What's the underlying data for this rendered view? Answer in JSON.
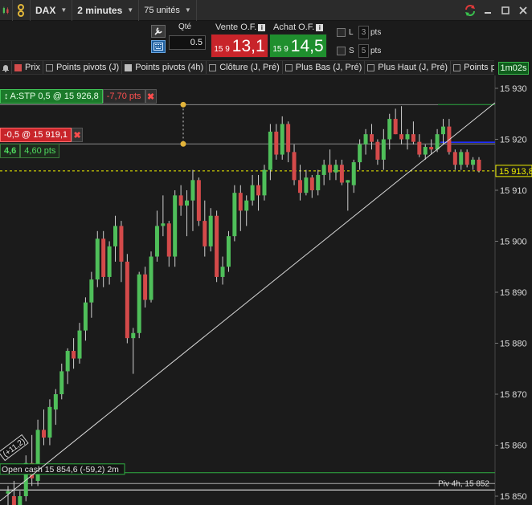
{
  "toolbar": {
    "instrument": "DAX",
    "timeframe": "2 minutes",
    "units": "75 unités"
  },
  "order": {
    "qty_label": "Qté",
    "qty_value": "0.5",
    "sell_label": "Vente O.F.",
    "sell_prefix": "15 9",
    "sell_price": "13,1",
    "buy_label": "Achat O.F.",
    "buy_prefix": "15 9",
    "buy_price": "14,5",
    "info_glyph": "i",
    "limit_label": "L",
    "limit_pts": "3",
    "stop_label": "S",
    "stop_pts": "5",
    "pts_label": "pts"
  },
  "indicators": [
    {
      "label": "Prix",
      "color": "#d24b4b"
    },
    {
      "label": "Points pivots (J)",
      "color": ""
    },
    {
      "label": "Points pivots (4h)",
      "color": "#bbbbbb"
    },
    {
      "label": "Clôture (J, Pré)",
      "color": ""
    },
    {
      "label": "Plus Bas (J, Pré)",
      "color": ""
    },
    {
      "label": "Plus Haut (J, Pré)",
      "color": ""
    },
    {
      "label": "Points piv",
      "color": ""
    }
  ],
  "timer": "1m02s",
  "positions": {
    "stop_order": {
      "name": "A:STP",
      "detail": "0,5 @ 15 926,8",
      "pnl": "-7,70 pts"
    },
    "limit_order": {
      "detail": "-0,5 @ 15 919,1"
    },
    "gain": {
      "value": "4,6",
      "pts": "4,60 pts"
    },
    "close_glyph": "✖"
  },
  "annotations": {
    "open_cash": "Open cash 15 854,6 (-59,2) 2m",
    "pivot": "Piv 4h, 15 852",
    "trend_tag": "(+11,2)"
  },
  "price_axis": {
    "labels": [
      "15 930",
      "15 920",
      "15 910",
      "15 900",
      "15 890",
      "15 880",
      "15 870",
      "15 860",
      "15 850"
    ],
    "current_price_label": "15 913,8"
  },
  "colors": {
    "up": "#4fbf5a",
    "down": "#d44a4a",
    "current_price": "#f2f200",
    "limit_line": "#1e2cff",
    "stop_line": "#1d8a2e",
    "grid": "#2c2c2c"
  },
  "chart_data": {
    "type": "candlestick",
    "price_range": [
      15845.5,
      15934
    ],
    "current_price": 15913.8,
    "levels": {
      "stop": 15926.8,
      "order": 15919.1,
      "limit": 15919.1,
      "pivot_4h": 15852,
      "open_cash": 15854.6
    },
    "candles": [
      {
        "o": 15850.5,
        "h": 15852.0,
        "l": 15845.5,
        "c": 15851.0
      },
      {
        "o": 15850.0,
        "h": 15853.0,
        "l": 15846.0,
        "c": 15847.0
      },
      {
        "o": 15847.0,
        "h": 15851.0,
        "l": 15845.5,
        "c": 15850.0
      },
      {
        "o": 15850.0,
        "h": 15858.0,
        "l": 15849.0,
        "c": 15856.5
      },
      {
        "o": 15856.5,
        "h": 15862.0,
        "l": 15852.0,
        "c": 15853.5
      },
      {
        "o": 15853.0,
        "h": 15865.0,
        "l": 15852.0,
        "c": 15863.0
      },
      {
        "o": 15863.0,
        "h": 15867.0,
        "l": 15860.0,
        "c": 15861.5
      },
      {
        "o": 15861.5,
        "h": 15869.0,
        "l": 15860.0,
        "c": 15867.5
      },
      {
        "o": 15867.0,
        "h": 15871.0,
        "l": 15864.0,
        "c": 15870.0
      },
      {
        "o": 15870.0,
        "h": 15876.0,
        "l": 15869.0,
        "c": 15874.5
      },
      {
        "o": 15874.5,
        "h": 15879.0,
        "l": 15872.0,
        "c": 15878.5
      },
      {
        "o": 15878.5,
        "h": 15881.0,
        "l": 15875.0,
        "c": 15877.0
      },
      {
        "o": 15877.0,
        "h": 15884.0,
        "l": 15876.0,
        "c": 15882.5
      },
      {
        "o": 15882.5,
        "h": 15889.0,
        "l": 15880.5,
        "c": 15888.0
      },
      {
        "o": 15888.0,
        "h": 15894.0,
        "l": 15885.0,
        "c": 15892.5
      },
      {
        "o": 15892.5,
        "h": 15902.0,
        "l": 15891.0,
        "c": 15900.5
      },
      {
        "o": 15900.5,
        "h": 15902.0,
        "l": 15891.0,
        "c": 15893.0
      },
      {
        "o": 15893.0,
        "h": 15900.0,
        "l": 15891.5,
        "c": 15899.0
      },
      {
        "o": 15899.0,
        "h": 15905.0,
        "l": 15896.0,
        "c": 15903.0
      },
      {
        "o": 15903.0,
        "h": 15904.0,
        "l": 15892.0,
        "c": 15896.0
      },
      {
        "o": 15896.0,
        "h": 15897.5,
        "l": 15880.0,
        "c": 15881.0
      },
      {
        "o": 15881.0,
        "h": 15883.0,
        "l": 15874.0,
        "c": 15882.0
      },
      {
        "o": 15882.0,
        "h": 15894.0,
        "l": 15881.0,
        "c": 15893.5
      },
      {
        "o": 15893.5,
        "h": 15895.0,
        "l": 15887.0,
        "c": 15888.5
      },
      {
        "o": 15888.5,
        "h": 15898.0,
        "l": 15888.0,
        "c": 15897.0
      },
      {
        "o": 15897.0,
        "h": 15906.0,
        "l": 15896.0,
        "c": 15903.0
      },
      {
        "o": 15903.0,
        "h": 15909.0,
        "l": 15901.0,
        "c": 15903.5
      },
      {
        "o": 15903.5,
        "h": 15904.0,
        "l": 15895.0,
        "c": 15897.0
      },
      {
        "o": 15897.0,
        "h": 15910.0,
        "l": 15895.0,
        "c": 15909.0
      },
      {
        "o": 15909.0,
        "h": 15911.0,
        "l": 15905.0,
        "c": 15907.0
      },
      {
        "o": 15907.0,
        "h": 15910.0,
        "l": 15901.0,
        "c": 15908.0
      },
      {
        "o": 15908.0,
        "h": 15914.0,
        "l": 15902.0,
        "c": 15912.0
      },
      {
        "o": 15912.0,
        "h": 15912.5,
        "l": 15903.0,
        "c": 15904.0
      },
      {
        "o": 15904.0,
        "h": 15908.0,
        "l": 15897.0,
        "c": 15899.0
      },
      {
        "o": 15899.0,
        "h": 15906.5,
        "l": 15898.0,
        "c": 15905.0
      },
      {
        "o": 15905.0,
        "h": 15906.0,
        "l": 15892.0,
        "c": 15893.0
      },
      {
        "o": 15893.0,
        "h": 15897.0,
        "l": 15891.5,
        "c": 15895.0
      },
      {
        "o": 15895.0,
        "h": 15902.0,
        "l": 15894.0,
        "c": 15901.0
      },
      {
        "o": 15901.0,
        "h": 15911.0,
        "l": 15900.0,
        "c": 15909.5
      },
      {
        "o": 15909.5,
        "h": 15911.0,
        "l": 15902.0,
        "c": 15906.0
      },
      {
        "o": 15906.0,
        "h": 15909.0,
        "l": 15903.0,
        "c": 15908.0
      },
      {
        "o": 15908.0,
        "h": 15913.0,
        "l": 15907.0,
        "c": 15911.0
      },
      {
        "o": 15911.0,
        "h": 15913.0,
        "l": 15906.0,
        "c": 15909.0
      },
      {
        "o": 15909.0,
        "h": 15915.0,
        "l": 15908.0,
        "c": 15914.0
      },
      {
        "o": 15914.0,
        "h": 15923.0,
        "l": 15912.0,
        "c": 15921.5
      },
      {
        "o": 15921.5,
        "h": 15923.0,
        "l": 15916.0,
        "c": 15917.0
      },
      {
        "o": 15917.0,
        "h": 15924.5,
        "l": 15916.0,
        "c": 15923.0
      },
      {
        "o": 15923.0,
        "h": 15923.5,
        "l": 15915.5,
        "c": 15917.5
      },
      {
        "o": 15917.5,
        "h": 15919.0,
        "l": 15911.0,
        "c": 15912.0
      },
      {
        "o": 15912.0,
        "h": 15915.0,
        "l": 15908.0,
        "c": 15909.5
      },
      {
        "o": 15909.5,
        "h": 15914.0,
        "l": 15909.0,
        "c": 15912.5
      },
      {
        "o": 15912.5,
        "h": 15913.0,
        "l": 15908.5,
        "c": 15910.0
      },
      {
        "o": 15910.0,
        "h": 15914.0,
        "l": 15909.0,
        "c": 15913.0
      },
      {
        "o": 15913.0,
        "h": 15916.0,
        "l": 15911.0,
        "c": 15915.0
      },
      {
        "o": 15915.0,
        "h": 15918.0,
        "l": 15912.0,
        "c": 15913.5
      },
      {
        "o": 15913.5,
        "h": 15916.0,
        "l": 15912.0,
        "c": 15915.0
      },
      {
        "o": 15915.0,
        "h": 15916.0,
        "l": 15911.0,
        "c": 15911.5
      },
      {
        "o": 15911.5,
        "h": 15912.0,
        "l": 15906.0,
        "c": 15912.0
      },
      {
        "o": 15911.0,
        "h": 15916.0,
        "l": 15909.5,
        "c": 15915.5
      },
      {
        "o": 15915.5,
        "h": 15920.0,
        "l": 15914.0,
        "c": 15919.0
      },
      {
        "o": 15919.0,
        "h": 15922.0,
        "l": 15917.0,
        "c": 15921.0
      },
      {
        "o": 15921.0,
        "h": 15923.0,
        "l": 15918.0,
        "c": 15919.5
      },
      {
        "o": 15919.5,
        "h": 15920.0,
        "l": 15915.0,
        "c": 15916.0
      },
      {
        "o": 15916.0,
        "h": 15922.0,
        "l": 15914.0,
        "c": 15920.0
      },
      {
        "o": 15920.0,
        "h": 15925.0,
        "l": 15918.0,
        "c": 15924.0
      },
      {
        "o": 15924.0,
        "h": 15926.0,
        "l": 15921.0,
        "c": 15921.0
      },
      {
        "o": 15921.0,
        "h": 15926.5,
        "l": 15919.0,
        "c": 15920.0
      },
      {
        "o": 15920.0,
        "h": 15922.0,
        "l": 15918.0,
        "c": 15921.0
      },
      {
        "o": 15921.0,
        "h": 15923.5,
        "l": 15919.0,
        "c": 15919.5
      },
      {
        "o": 15919.5,
        "h": 15921.0,
        "l": 15916.5,
        "c": 15917.0
      },
      {
        "o": 15917.0,
        "h": 15919.0,
        "l": 15916.0,
        "c": 15918.5
      },
      {
        "o": 15918.5,
        "h": 15920.0,
        "l": 15917.0,
        "c": 15918.0
      },
      {
        "o": 15918.0,
        "h": 15922.0,
        "l": 15917.5,
        "c": 15921.0
      },
      {
        "o": 15921.0,
        "h": 15924.0,
        "l": 15919.0,
        "c": 15922.5
      },
      {
        "o": 15922.5,
        "h": 15924.0,
        "l": 15917.0,
        "c": 15917.5
      },
      {
        "o": 15917.5,
        "h": 15918.0,
        "l": 15914.0,
        "c": 15915.0
      },
      {
        "o": 15915.0,
        "h": 15918.0,
        "l": 15914.0,
        "c": 15917.5
      },
      {
        "o": 15917.5,
        "h": 15918.0,
        "l": 15914.5,
        "c": 15915.0
      },
      {
        "o": 15915.0,
        "h": 15916.5,
        "l": 15914.0,
        "c": 15916.0
      },
      {
        "o": 15916.0,
        "h": 15916.5,
        "l": 15913.5,
        "c": 15913.8
      }
    ]
  }
}
